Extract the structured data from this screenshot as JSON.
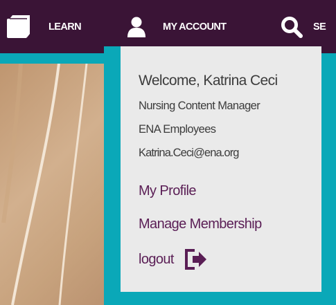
{
  "nav": {
    "learn": {
      "label": "LEARN",
      "icon": "book-icon"
    },
    "account": {
      "label": "MY ACCOUNT",
      "icon": "user-icon"
    },
    "search": {
      "label": "SE",
      "icon": "search-icon"
    }
  },
  "account_menu": {
    "welcome": "Welcome, Katrina Ceci",
    "role": "Nursing Content Manager",
    "group": "ENA Employees",
    "email": "Katrina.Ceci@ena.org",
    "links": {
      "my_profile": "My Profile",
      "manage_membership": "Manage Membership",
      "logout": "logout"
    },
    "logout_icon": "logout-icon"
  },
  "colors": {
    "navbar": "#3a1436",
    "accent_teal": "#0aa8b8",
    "dropdown_bg": "#eaeaea",
    "link": "#5a1e55",
    "text": "#3c3c3c"
  }
}
